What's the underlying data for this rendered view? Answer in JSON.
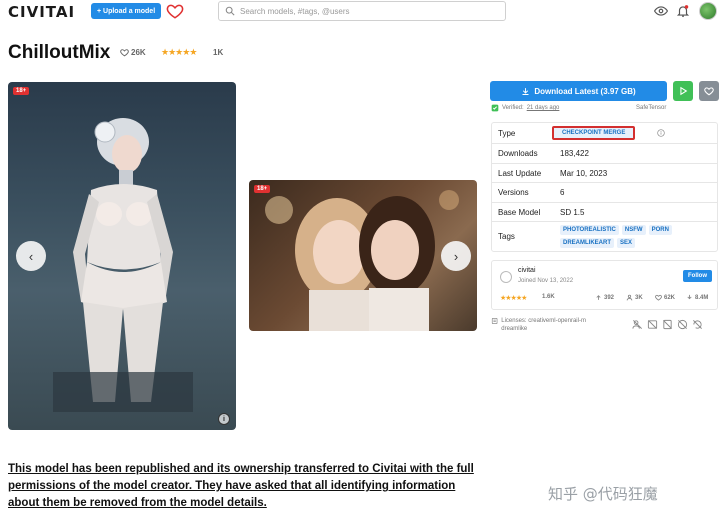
{
  "header": {
    "logo": "CIVITAI",
    "upload_label": "+ Upload a model",
    "search_placeholder": "Search models, #tags, @users"
  },
  "model": {
    "title": "ChilloutMix",
    "likes": "26K",
    "rating_count": "1K"
  },
  "gallery": {
    "badge": "18+",
    "badge2": "18+",
    "prev_icon": "‹",
    "next_icon": "›"
  },
  "actions": {
    "download_label": "Download Latest (3.97 GB)",
    "verified_prefix": "Verified:",
    "verified_date": "21 days ago",
    "format": "SafeTensor"
  },
  "details": {
    "rows": [
      {
        "key": "Type",
        "value": "CHECKPOINT MERGE"
      },
      {
        "key": "Downloads",
        "value": "183,422"
      },
      {
        "key": "Last Update",
        "value": "Mar 10, 2023"
      },
      {
        "key": "Versions",
        "value": "6"
      },
      {
        "key": "Base Model",
        "value": "SD 1.5"
      },
      {
        "key": "Tags",
        "value": ""
      }
    ],
    "tags": [
      "PHOTOREALISTIC",
      "NSFW",
      "PORN",
      "DREAMLIKEART",
      "SEX"
    ]
  },
  "creator": {
    "name": "civitai",
    "joined": "Joined Nov 13, 2022",
    "follow_label": "Follow",
    "rating_count": "1.6K",
    "uploads": "392",
    "followers": "3K",
    "favorites": "62K",
    "downloads": "8.4M"
  },
  "license": {
    "text": "Licenses: creativeml-openrail-m dreamlike"
  },
  "description": {
    "text": "This model has been republished and its ownership transferred to Civitai with the full permissions of the model creator. They have asked that all identifying information about them be removed from the model details."
  },
  "watermark": "知乎 @代码狂魔",
  "colors": {
    "primary": "#228be6",
    "success": "#40c057",
    "danger": "#e03131",
    "highlight_box": "#d32f2f",
    "star": "#f5a623"
  }
}
